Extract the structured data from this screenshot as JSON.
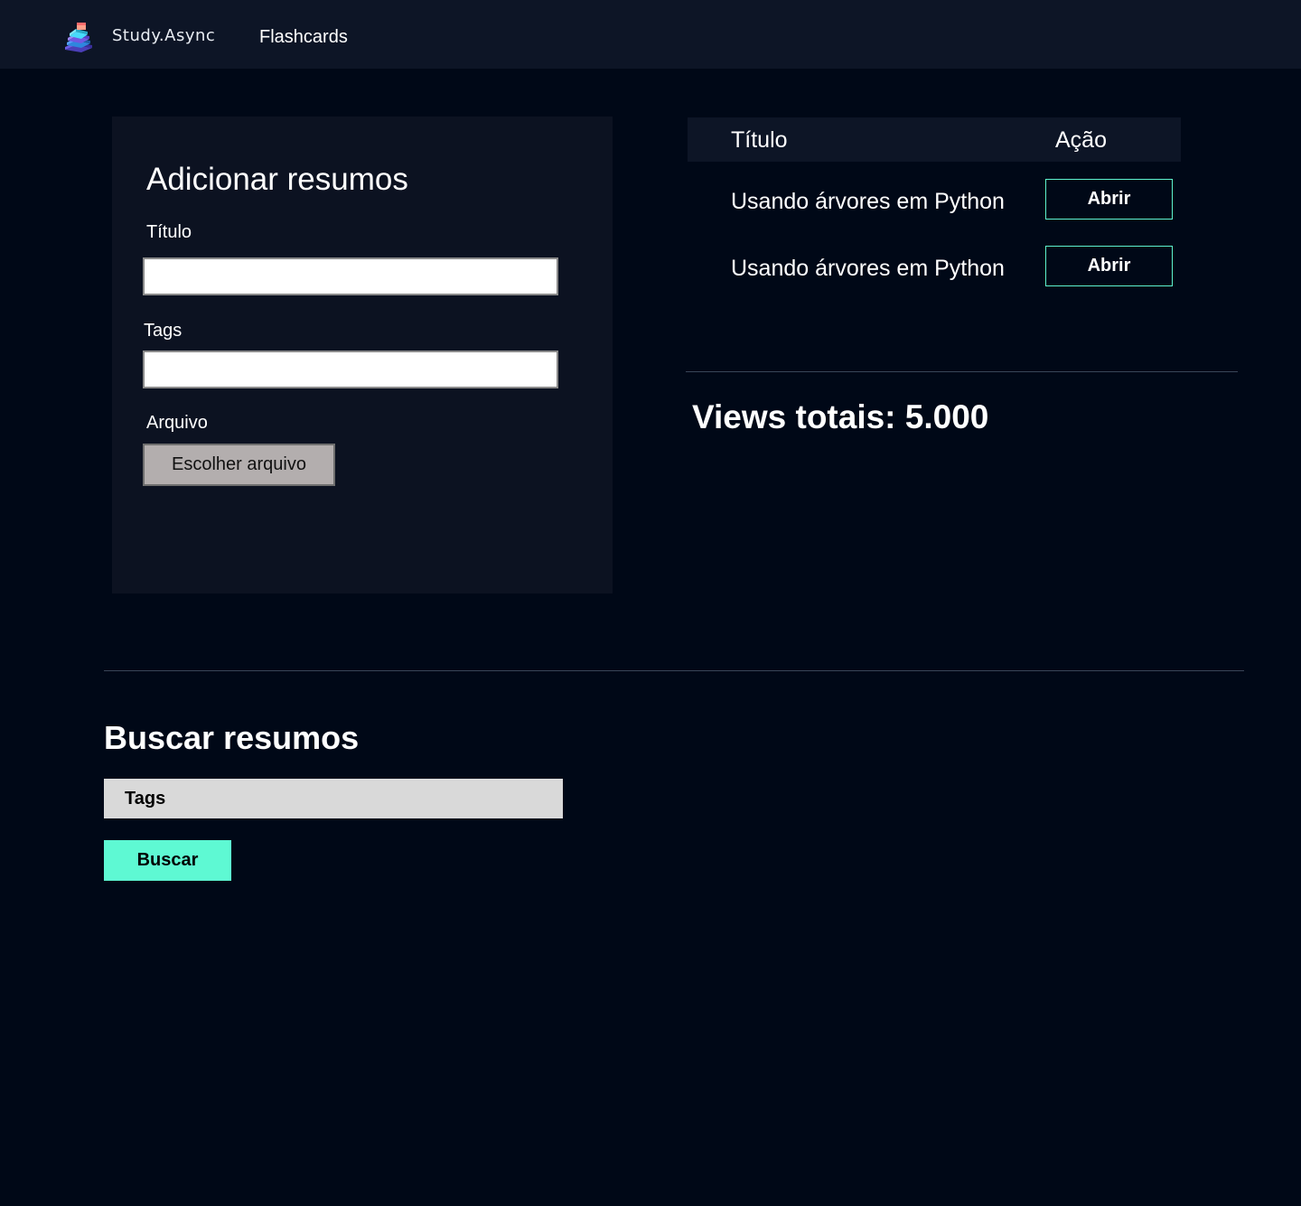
{
  "header": {
    "brand": "Study.Async",
    "nav_flashcards": "Flashcards"
  },
  "add_form": {
    "title": "Adicionar resumos",
    "title_label": "Título",
    "title_value": "",
    "tags_label": "Tags",
    "tags_value": "",
    "file_label": "Arquivo",
    "file_button": "Escolher arquivo"
  },
  "summaries": {
    "col_title": "Título",
    "col_action": "Ação",
    "rows": [
      {
        "title": "Usando árvores em Python",
        "action": "Abrir"
      },
      {
        "title": "Usando árvores em Python",
        "action": "Abrir"
      }
    ]
  },
  "stats": {
    "views": "Views totais: 5.000"
  },
  "search": {
    "title": "Buscar resumos",
    "tags_placeholder": "Tags",
    "button": "Buscar"
  },
  "colors": {
    "background": "#000817",
    "panel": "#0c1221",
    "accent": "#5ef9d3"
  },
  "icons": {
    "logo": "book-stack-icon"
  }
}
